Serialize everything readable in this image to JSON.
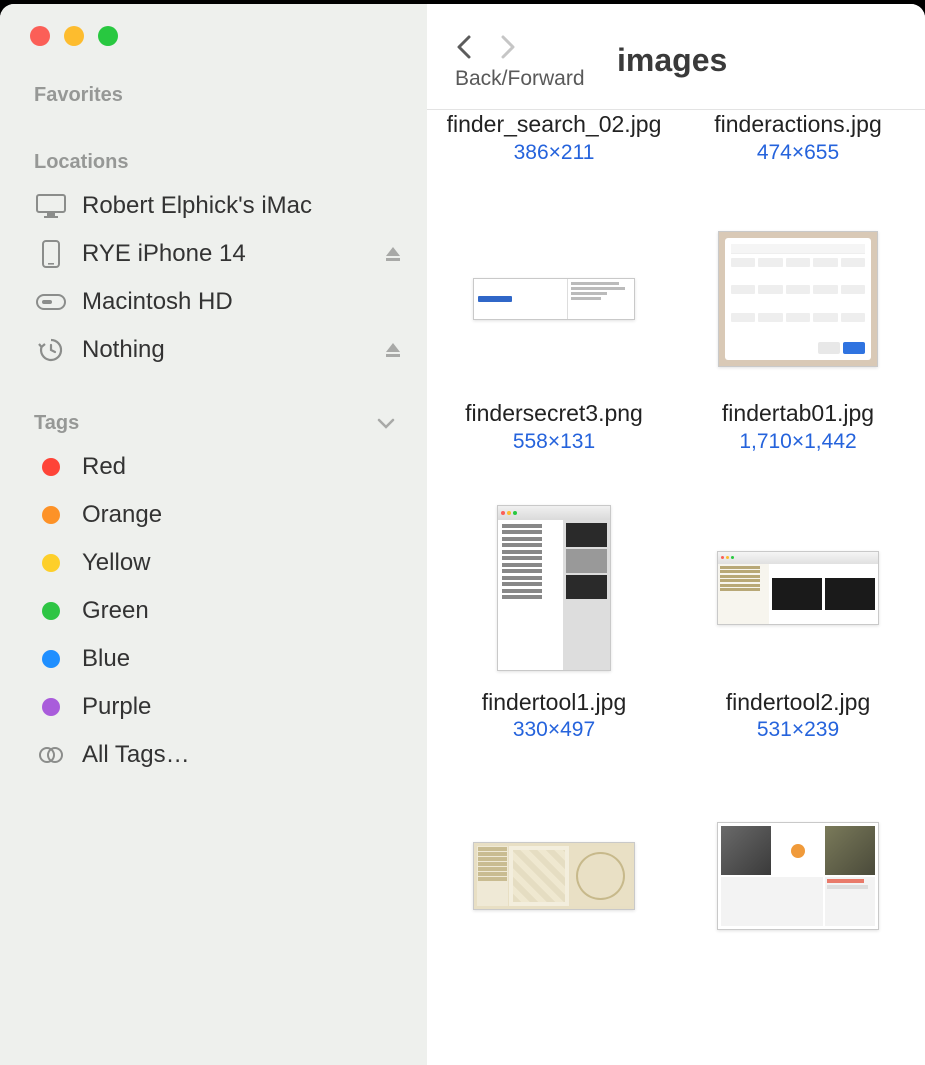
{
  "window": {
    "close": "close",
    "minimize": "minimize",
    "maximize": "maximize"
  },
  "sidebar": {
    "favorites_label": "Favorites",
    "locations_label": "Locations",
    "tags_label": "Tags",
    "locations": [
      {
        "icon": "imac",
        "label": "Robert Elphick's iMac",
        "eject": false
      },
      {
        "icon": "iphone",
        "label": "RYE iPhone 14",
        "eject": true
      },
      {
        "icon": "disk",
        "label": "Macintosh HD",
        "eject": false
      },
      {
        "icon": "timemachine",
        "label": "Nothing",
        "eject": true
      }
    ],
    "tags": [
      {
        "color": "#fe4438",
        "label": "Red"
      },
      {
        "color": "#fd9227",
        "label": "Orange"
      },
      {
        "color": "#fdcf2a",
        "label": "Yellow"
      },
      {
        "color": "#2ec544",
        "label": "Green"
      },
      {
        "color": "#1f8fff",
        "label": "Blue"
      },
      {
        "color": "#a95cdb",
        "label": "Purple"
      }
    ],
    "all_tags_label": "All Tags…"
  },
  "toolbar": {
    "back_forward_label": "Back/Forward",
    "title": "images"
  },
  "files": [
    {
      "name": "finder_search_02.jpg",
      "dimensions": "386×211",
      "thumb_hidden": true,
      "tw": 0,
      "th": 0,
      "style": "none"
    },
    {
      "name": "finderactions.jpg",
      "dimensions": "474×655",
      "thumb_hidden": true,
      "tw": 0,
      "th": 0,
      "style": "none"
    },
    {
      "name": "findersecret3.png",
      "dimensions": "558×131",
      "thumb_hidden": false,
      "tw": 162,
      "th": 42,
      "style": "menu-strip"
    },
    {
      "name": "findertab01.jpg",
      "dimensions": "1,710×1,442",
      "thumb_hidden": false,
      "tw": 160,
      "th": 136,
      "style": "toolbar-customize"
    },
    {
      "name": "findertool1.jpg",
      "dimensions": "330×497",
      "thumb_hidden": false,
      "tw": 114,
      "th": 166,
      "style": "context-menu"
    },
    {
      "name": "findertool2.jpg",
      "dimensions": "531×239",
      "thumb_hidden": false,
      "tw": 162,
      "th": 74,
      "style": "coverflow"
    },
    {
      "name": "",
      "dimensions": "",
      "thumb_hidden": false,
      "tw": 162,
      "th": 68,
      "style": "map-tiles"
    },
    {
      "name": "",
      "dimensions": "",
      "thumb_hidden": false,
      "tw": 162,
      "th": 108,
      "style": "annotated"
    }
  ]
}
